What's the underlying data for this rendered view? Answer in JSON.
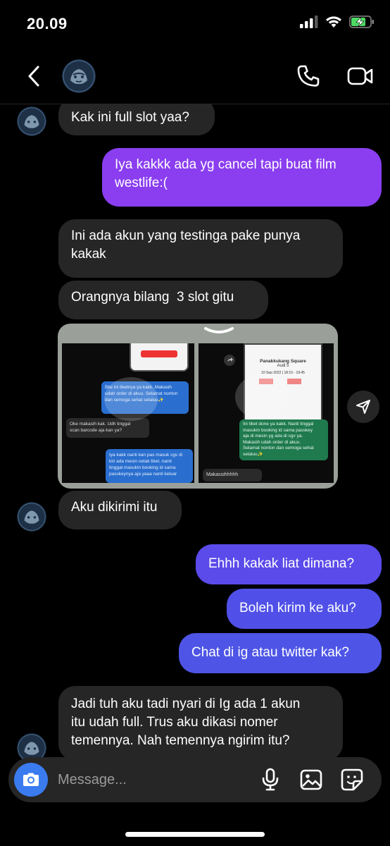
{
  "status_bar": {
    "time": "20.09"
  },
  "header": {},
  "messages": [
    {
      "direction": "in",
      "text": "Kak ini full slot yaa?"
    },
    {
      "direction": "out",
      "text": "Iya kakkk ada yg cancel tapi buat film\nwestlife:("
    },
    {
      "direction": "in",
      "text": "Ini ada akun yang testinga pake punya\nkakak"
    },
    {
      "direction": "in",
      "text": "Orangnya bilang  3 slot gitu"
    },
    {
      "direction": "in",
      "text": "Aku dikirimi itu"
    },
    {
      "direction": "out",
      "text": "Ehhh kakak liat dimana?"
    },
    {
      "direction": "out",
      "text": "Boleh kirim ke aku?"
    },
    {
      "direction": "out",
      "text": "Chat di ig atau twitter kak?"
    },
    {
      "direction": "in",
      "text": "Jadi tuh aku tadi nyari di Ig ada 1 akun\nitu udah full. Trus aku dikasi nomer\ntemennya. Nah temennya ngirim itu?"
    }
  ],
  "shared_image": {
    "left_panel": {
      "bubbles": [
        "Btw ini tiketnya ya kakk. Makasih\nudah order di akuu. Selamat nonton\ndan semoga sehat selaluu✨",
        "Oke makasih kak. Udh tinggal\nscan barcode aja kan ya?",
        "Iya kakk nanti kan pas masuk cgv di\nkiri ada mesin cetak tiket. nanti\ntinggal masukin booking id sama\npasskeynya aja yaaa nanti keluar"
      ]
    },
    "right_panel": {
      "ticket_venue": "Panakkukang Square",
      "ticket_screen": "Audi 5",
      "ticket_date": "10 Sep 2022 | 18:10 - 19:45",
      "bubbles": [
        "Ini tiket done ya kakk. Nanti tinggal\nmasukin booking id sama passkey\naja di mesin yg ada di cgv ya.\nMakasih udah order di akuu.\nSelamat nonton dan semoga sehat\nselaluu✨",
        "Makassihhhhh"
      ]
    }
  },
  "composer": {
    "placeholder": "Message..."
  },
  "colors": {
    "incoming_bubble": "#262626",
    "outgoing_top": "#8a3ef0",
    "outgoing_bottom": "#4e55e6",
    "camera_button": "#3a7bf0",
    "battery": "#4cd964"
  }
}
